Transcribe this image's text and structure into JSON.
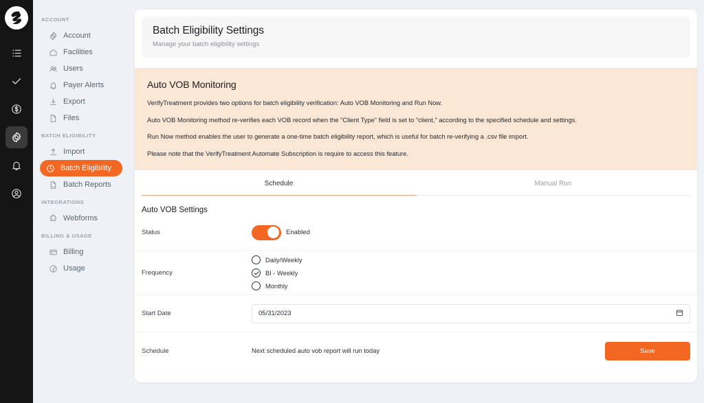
{
  "rail": {
    "logo": "app-logo",
    "items": [
      {
        "name": "list-icon"
      },
      {
        "name": "check-icon"
      },
      {
        "name": "dollar-circle-icon"
      },
      {
        "name": "gear-icon",
        "active": true
      },
      {
        "name": "bell-icon"
      },
      {
        "name": "user-circle-icon"
      }
    ]
  },
  "sidebar": {
    "sections": [
      {
        "label": "ACCOUNT",
        "items": [
          {
            "label": "Account",
            "icon": "gear-icon"
          },
          {
            "label": "Facilities",
            "icon": "home-icon"
          },
          {
            "label": "Users",
            "icon": "users-icon"
          },
          {
            "label": "Payer Alerts",
            "icon": "bell-icon"
          },
          {
            "label": "Export",
            "icon": "download-icon"
          },
          {
            "label": "Files",
            "icon": "file-icon"
          }
        ]
      },
      {
        "label": "BATCH ELIGIBILITY",
        "items": [
          {
            "label": "Import",
            "icon": "upload-icon"
          },
          {
            "label": "Batch Eligibility",
            "icon": "clock-icon",
            "active": true
          },
          {
            "label": "Batch Reports",
            "icon": "csv-file-icon"
          }
        ]
      },
      {
        "label": "INTEGRATIONS",
        "items": [
          {
            "label": "Webforms",
            "icon": "puzzle-icon"
          }
        ]
      },
      {
        "label": "BILLING & USAGE",
        "items": [
          {
            "label": "Billing",
            "icon": "credit-card-icon"
          },
          {
            "label": "Usage",
            "icon": "pie-chart-icon"
          }
        ]
      }
    ]
  },
  "header": {
    "title": "Batch Eligibility Settings",
    "subtitle": "Manage your batch eligibility settings"
  },
  "info_panel": {
    "title": "Auto VOB Monitoring",
    "paragraphs": [
      "VerifyTreatment provides two options for batch eligibility verification: Auto VOB Monitoring and Run Now.",
      "Auto VOB Monitoring method re-verifies each VOB record when the \"Client Type\" field is set to \"client,\" according to the specified schedule and settings.",
      "Run Now method enables the user to generate a one-time batch eligibility report, which is useful for batch re-verifying a .csv file import.",
      "Please note that the VerifyTreatment Automate Subscription is require to access this feature."
    ]
  },
  "tabs": [
    {
      "label": "Schedule",
      "active": true
    },
    {
      "label": "Manual Run",
      "active": false
    }
  ],
  "settings": {
    "section_title": "Auto VOB Settings",
    "status": {
      "label": "Status",
      "toggle_state": "Enabled",
      "enabled": true
    },
    "frequency": {
      "label": "Frequency",
      "options": [
        {
          "label": "Daily/Weekly",
          "selected": false
        },
        {
          "label": "BI - Weekly",
          "selected": true
        },
        {
          "label": "Monthly",
          "selected": false
        }
      ]
    },
    "start_date": {
      "label": "Start Date",
      "value": "05/31/2023",
      "picker_icon": "calendar-icon"
    },
    "schedule": {
      "label": "Schedule",
      "message": "Next scheduled auto vob report will run today",
      "save_label": "Save"
    }
  },
  "colors": {
    "accent": "#f26722",
    "rail_bg": "#141414",
    "sidebar_bg": "#eef1f5",
    "info_bg": "#fae7d6",
    "tab_underline": "#f3a584"
  }
}
